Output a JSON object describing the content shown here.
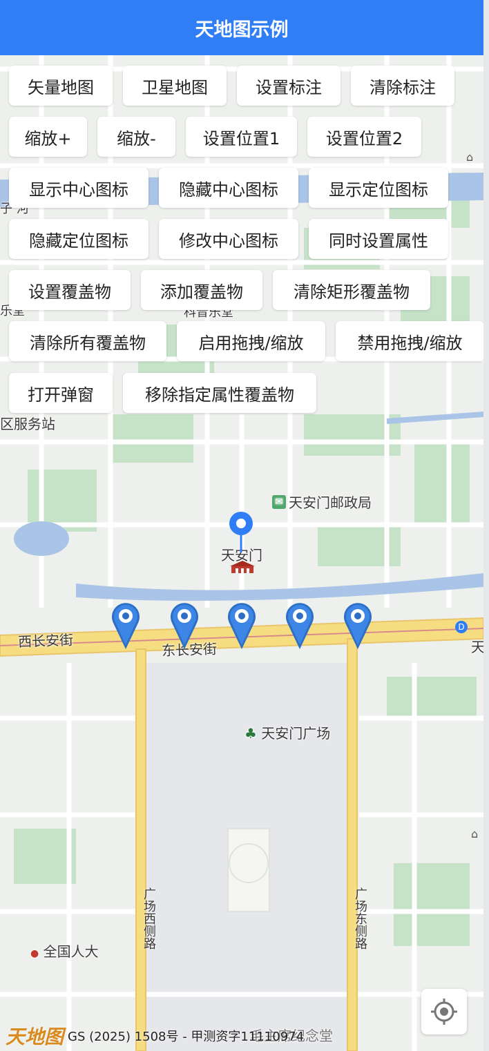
{
  "header": {
    "title": "天地图示例"
  },
  "buttons": [
    "矢量地图",
    "卫星地图",
    "设置标注",
    "清除标注",
    "缩放+",
    "缩放-",
    "设置位置1",
    "设置位置2",
    "显示中心图标",
    "隐藏中心图标",
    "显示定位图标",
    "隐藏定位图标",
    "修改中心图标",
    "同时设置属性",
    "设置覆盖物",
    "添加覆盖物",
    "清除矩形覆盖物",
    "清除所有覆盖物",
    "启用拖拽/缩放",
    "禁用拖拽/缩放",
    "打开弹窗",
    "移除指定属性覆盖物"
  ],
  "map_labels": {
    "service_station": "区服务站",
    "post_office": "天安门邮政局",
    "tiananmen": "天安门",
    "west_changan": "西长安街",
    "east_changan": "东长安街",
    "square": "天安门广场",
    "npc": "全国人大",
    "west_road": "广场西侧路",
    "east_road": "广场东侧路",
    "memorial": "毛主席纪念堂",
    "right_edge": "天",
    "music_hall": "科音乐堂",
    "left_top": "子 河",
    "left_mid": "乐堂"
  },
  "footer": {
    "logo": "天地图",
    "copyright": "GS (2025) 1508号 - 甲测资字11110974"
  },
  "colors": {
    "header": "#2f7ef5",
    "marker": "#2f7ef5",
    "road": "#f6dd82",
    "water": "#a9c4e6",
    "green": "#c6e2c8"
  },
  "icons": {
    "locate": "crosshair-icon",
    "marker": "map-pin-icon",
    "landmark": "tiananmen-gate-icon"
  }
}
